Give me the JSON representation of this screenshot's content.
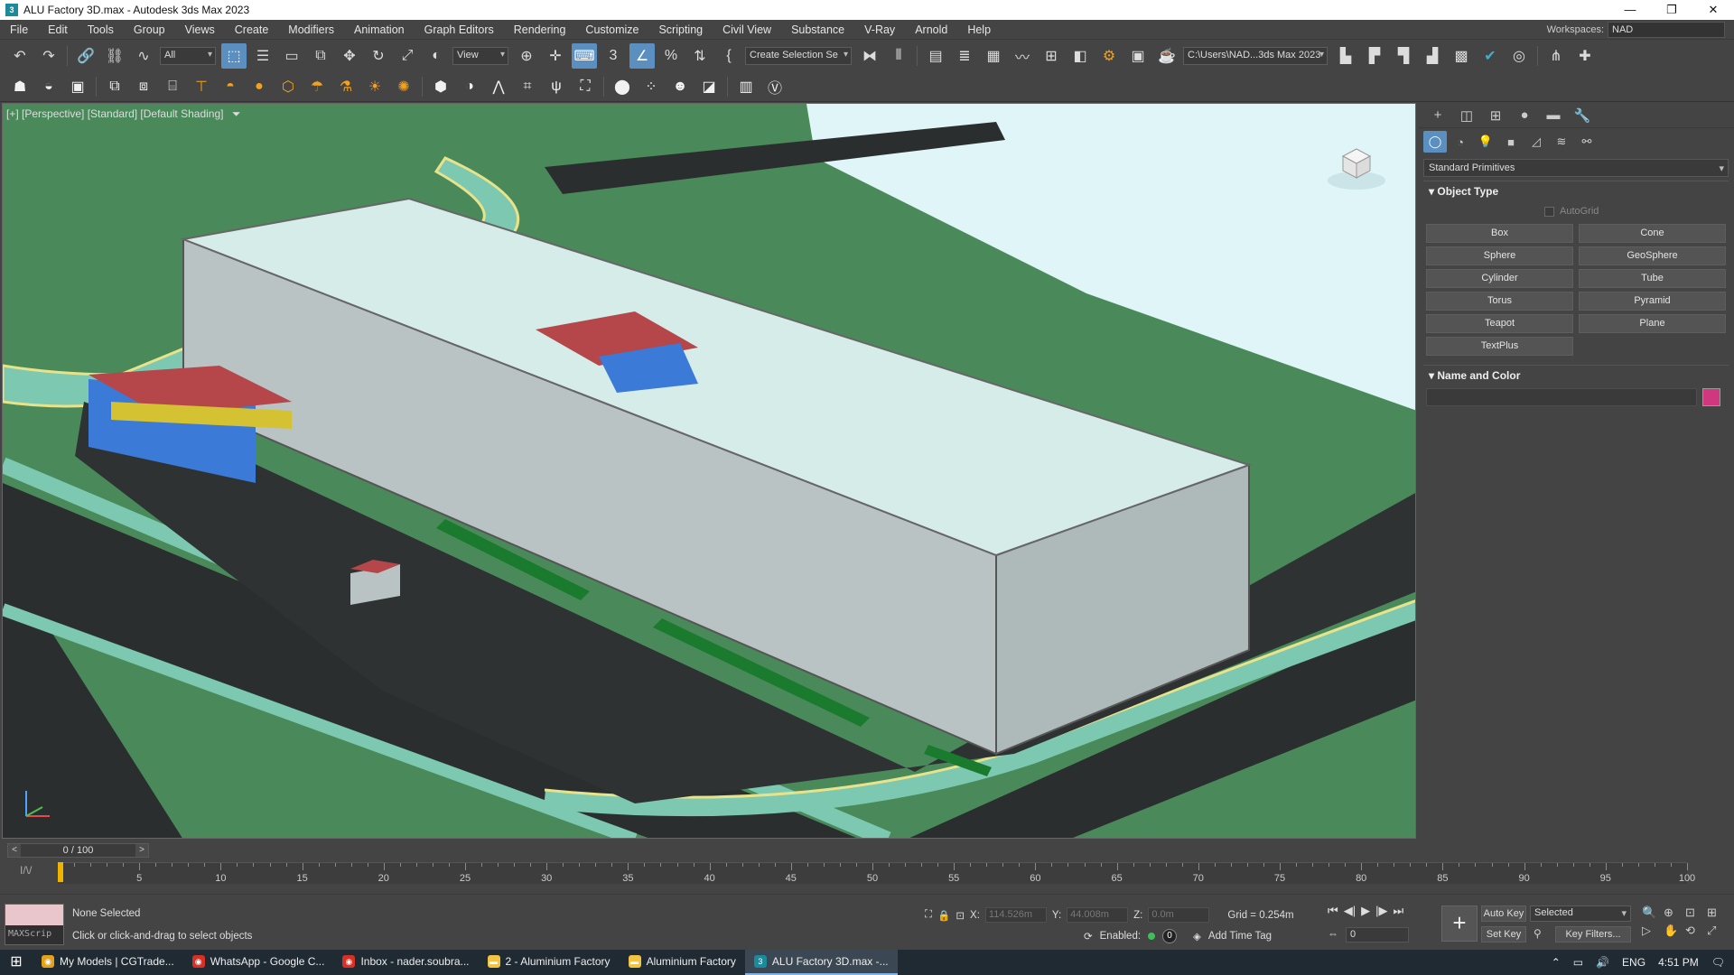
{
  "window": {
    "title": "ALU Factory 3D.max - Autodesk 3ds Max 2023",
    "controls": [
      "—",
      "❐",
      "✕"
    ]
  },
  "menu": {
    "items": [
      "File",
      "Edit",
      "Tools",
      "Group",
      "Views",
      "Create",
      "Modifiers",
      "Animation",
      "Graph Editors",
      "Rendering",
      "Customize",
      "Scripting",
      "Civil View",
      "Substance",
      "V-Ray",
      "Arnold",
      "Help"
    ],
    "workspaces_label": "Workspaces:",
    "workspaces_value": "NAD"
  },
  "toolbar": {
    "filter_value": "All",
    "refcoord_value": "View",
    "selection_set_value": "Create Selection Se",
    "project_path": "C:\\Users\\NAD...3ds Max 2023"
  },
  "viewport": {
    "label": "[+] [Perspective] [Standard] [Default Shading]",
    "filter_icon": "funnel-icon",
    "colors": {
      "grass": "#4a8a5a",
      "sky": "#dff5f7",
      "road": "#2b2e2f",
      "sidewalk": "#7cc8b0",
      "curb": "#e8e28a",
      "roof": "#d6ece9",
      "wall": "#b9c3c4"
    }
  },
  "command_panel": {
    "category": "Standard Primitives",
    "object_type_title": "Object Type",
    "autogrid_label": "AutoGrid",
    "buttons": [
      "Box",
      "Cone",
      "Sphere",
      "GeoSphere",
      "Cylinder",
      "Tube",
      "Torus",
      "Pyramid",
      "Teapot",
      "Plane",
      "TextPlus"
    ],
    "name_color_title": "Name and Color",
    "swatch_color": "#d0377e"
  },
  "timeline": {
    "slider_text": "0 / 100",
    "ticks": [
      5,
      10,
      15,
      20,
      25,
      30,
      35,
      40,
      45,
      50,
      55,
      60,
      65,
      70,
      75,
      80,
      85,
      90,
      95,
      100
    ]
  },
  "status": {
    "maxscript_label": "MAXScrip",
    "selection": "None Selected",
    "prompt": "Click or click-and-drag to select objects",
    "x_label": "X:",
    "x_value": "114.526m",
    "y_label": "Y:",
    "y_value": "44.008m",
    "z_label": "Z:",
    "z_value": "0.0m",
    "grid": "Grid = 0.254m",
    "enabled_label": "Enabled:",
    "enabled_value": "0",
    "add_time_tag": "Add Time Tag",
    "frame_value": "0",
    "auto_key": "Auto Key",
    "set_key": "Set Key",
    "selected_value": "Selected",
    "key_filters": "Key Filters..."
  },
  "taskbar": {
    "tasks": [
      {
        "label": "My Models | CGTrade...",
        "color": "#e3a21b",
        "icon": "chrome-icon"
      },
      {
        "label": "WhatsApp - Google C...",
        "color": "#d93025",
        "icon": "chrome-icon"
      },
      {
        "label": "Inbox - nader.soubra...",
        "color": "#d93025",
        "icon": "chrome-icon"
      },
      {
        "label": "2 - Aluminium Factory",
        "color": "#f3c343",
        "icon": "folder-icon"
      },
      {
        "label": "Aluminium Factory",
        "color": "#f3c343",
        "icon": "folder-icon"
      },
      {
        "label": "ALU Factory 3D.max -...",
        "color": "#1b8a9c",
        "icon": "3dsmax-icon"
      }
    ],
    "lang": "ENG",
    "time": "4:51 PM"
  }
}
